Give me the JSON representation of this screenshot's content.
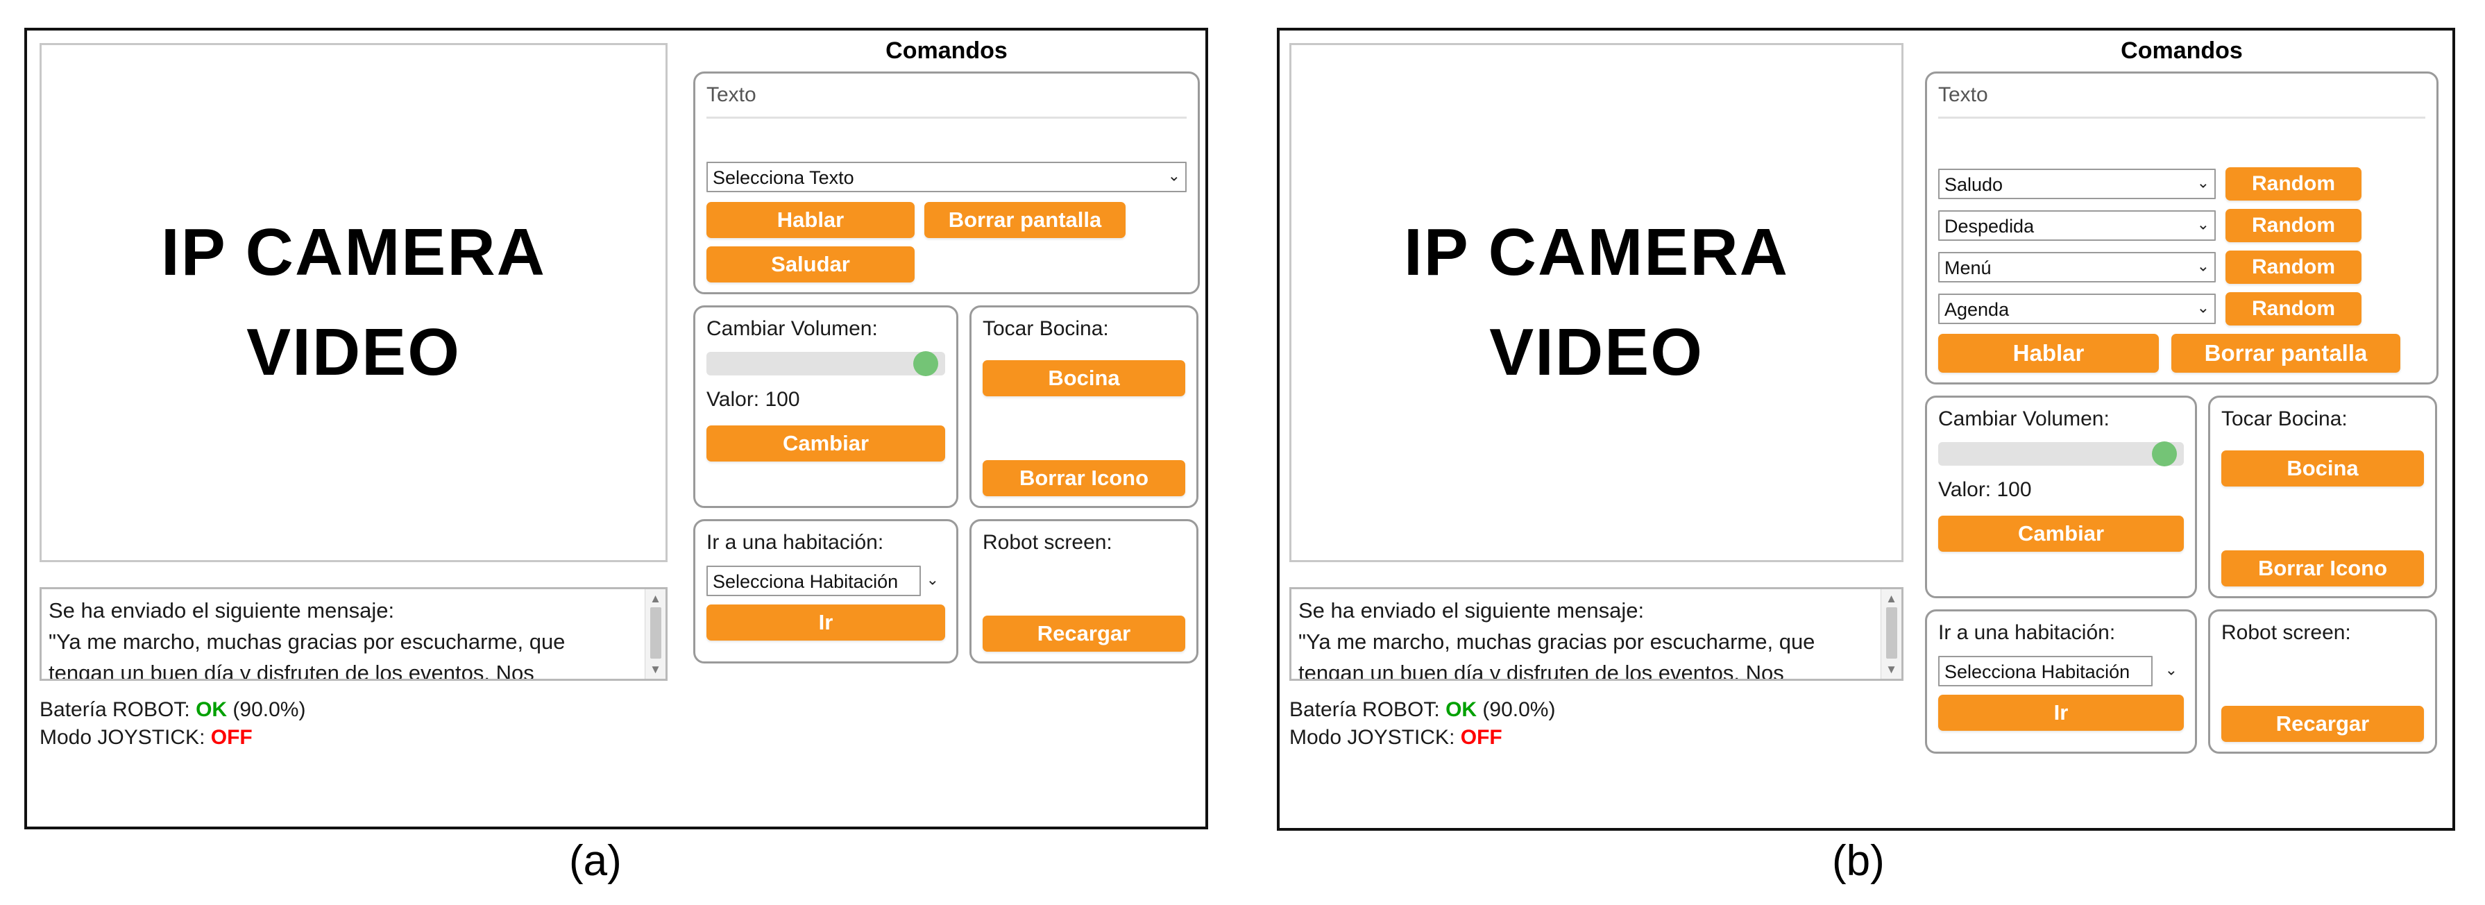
{
  "figure": {
    "caption_a": "(a)",
    "caption_b": "(b)"
  },
  "video": {
    "line1": "IP CAMERA",
    "line2": "VIDEO"
  },
  "log": {
    "text": "Se ha enviado el siguiente mensaje:\n\"Ya me marcho, muchas gracias por escucharme, que\ntengan un buen día y disfruten de los eventos. Nos",
    "scroll_up_icon": "▲",
    "scroll_down_icon": "▼"
  },
  "status": {
    "battery_label": "Batería ROBOT: ",
    "battery_state": "OK",
    "battery_percent": " (90.0%)",
    "joystick_label": "Modo JOYSTICK: ",
    "joystick_state": "OFF"
  },
  "commands": {
    "title": "Comandos"
  },
  "text_card": {
    "label": "Texto",
    "placeholder": "Texto"
  },
  "panel_a": {
    "select_texto": "Selecciona Texto",
    "btn_hablar": "Hablar",
    "btn_borrar_pantalla": "Borrar pantalla",
    "btn_saludar": "Saludar"
  },
  "panel_b": {
    "random_rows": [
      {
        "select": "Saludo",
        "button": "Random"
      },
      {
        "select": "Despedida",
        "button": "Random"
      },
      {
        "select": "Menú",
        "button": "Random"
      },
      {
        "select": "Agenda",
        "button": "Random"
      }
    ],
    "btn_hablar": "Hablar",
    "btn_borrar_pantalla": "Borrar pantalla"
  },
  "volume_card": {
    "label": "Cambiar Volumen:",
    "valor": "Valor: 100",
    "slider_value": 100,
    "button": "Cambiar"
  },
  "horn_card": {
    "label": "Tocar Bocina:",
    "btn_bocina": "Bocina",
    "btn_borrar_icono": "Borrar Icono"
  },
  "room_card": {
    "label": "Ir a una habitación:",
    "select": "Selecciona Habitación",
    "button": "Ir"
  },
  "robot_card": {
    "label": "Robot screen:",
    "button": "Recargar"
  },
  "icons": {
    "chevron_down": "⌄"
  },
  "colors": {
    "accent_orange": "#f7931e",
    "slider_thumb_green": "#74c476",
    "ok_green": "#00a000",
    "off_red": "#ff0000",
    "frame_black": "#111111",
    "card_border_gray": "#9a9a9a"
  }
}
